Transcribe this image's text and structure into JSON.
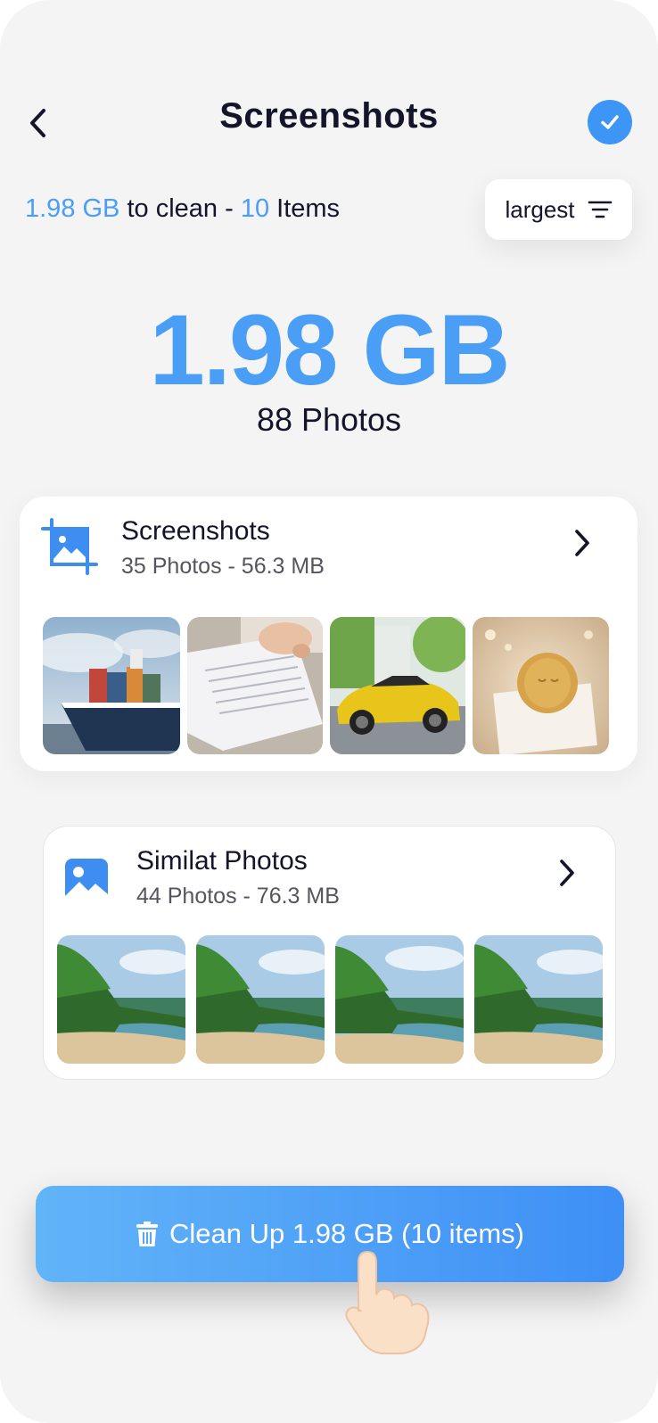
{
  "header": {
    "title": "Screenshots"
  },
  "summary": {
    "size": "1.98 GB",
    "to_clean": "to clean -",
    "count": "10",
    "items_label": "Items"
  },
  "sort": {
    "label": "largest"
  },
  "total": {
    "size": "1.98 GB",
    "photos": "88 Photos"
  },
  "groups": [
    {
      "title": "Screenshots",
      "subtitle": "35 Photos - 56.3 MB",
      "icon": "crop-image-icon",
      "thumbnails": [
        "cargo-ship",
        "documents-hand",
        "yellow-sports-car",
        "candle-decor"
      ]
    },
    {
      "title": "Similat Photos",
      "subtitle": "44 Photos - 76.3 MB",
      "icon": "image-icon",
      "thumbnails": [
        "tropical-beach",
        "tropical-beach",
        "tropical-beach",
        "tropical-beach"
      ]
    }
  ],
  "clean_button": {
    "label": "Clean Up 1.98 GB (10 items)"
  },
  "colors": {
    "accent": "#4a9ef5",
    "text": "#14142b",
    "background": "#f4f4f5"
  }
}
